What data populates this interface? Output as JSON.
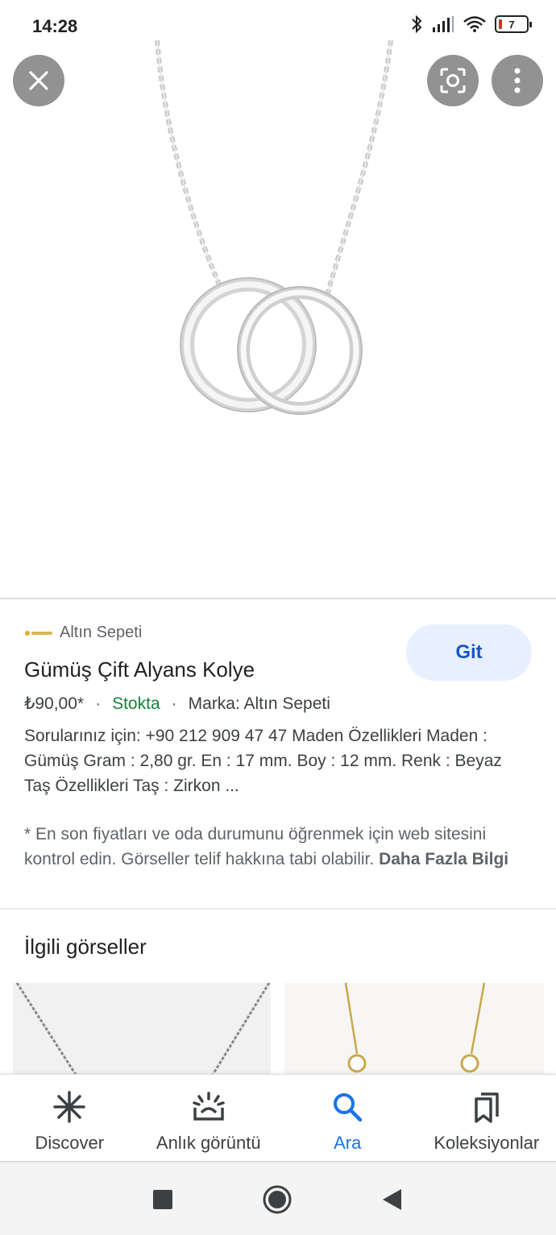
{
  "status_bar": {
    "time": "14:28",
    "battery": "7"
  },
  "hero": {
    "close_icon": "close-icon",
    "lens_icon": "google-lens-icon",
    "more_icon": "more-vert-icon"
  },
  "product": {
    "source_name": "Altın Sepeti",
    "title": "Gümüş Çift Alyans Kolye",
    "price": "₺90,00*",
    "stock": "Stokta",
    "brand": "Marka: Altın Sepeti",
    "description": "Sorularınız için: +90 212 909 47 47 Maden Özellikleri Maden : Gümüş Gram : 2,80 gr. En : 17 mm. Boy : 12 mm. Renk : Beyaz Taş Özellikleri Taş : Zirkon ...",
    "disclaimer": "* En son fiyatları ve oda durumunu öğrenmek için web sitesini kontrol edin. Görseller telif hakkına tabi olabilir.",
    "more_info": "Daha Fazla Bilgi",
    "go_button": "Git"
  },
  "related": {
    "title": "İlgili görseller"
  },
  "bottom_nav": {
    "items": [
      {
        "label": "Discover",
        "icon": "asterisk-icon",
        "active": false
      },
      {
        "label": "Anlık görüntü",
        "icon": "snapshot-icon",
        "active": false
      },
      {
        "label": "Ara",
        "icon": "search-icon",
        "active": true
      },
      {
        "label": "Koleksiyonlar",
        "icon": "collections-icon",
        "active": false
      }
    ]
  },
  "colors": {
    "accent": "#1a73e8",
    "stock_green": "#188038",
    "go_button_bg": "#e8f0fe"
  }
}
